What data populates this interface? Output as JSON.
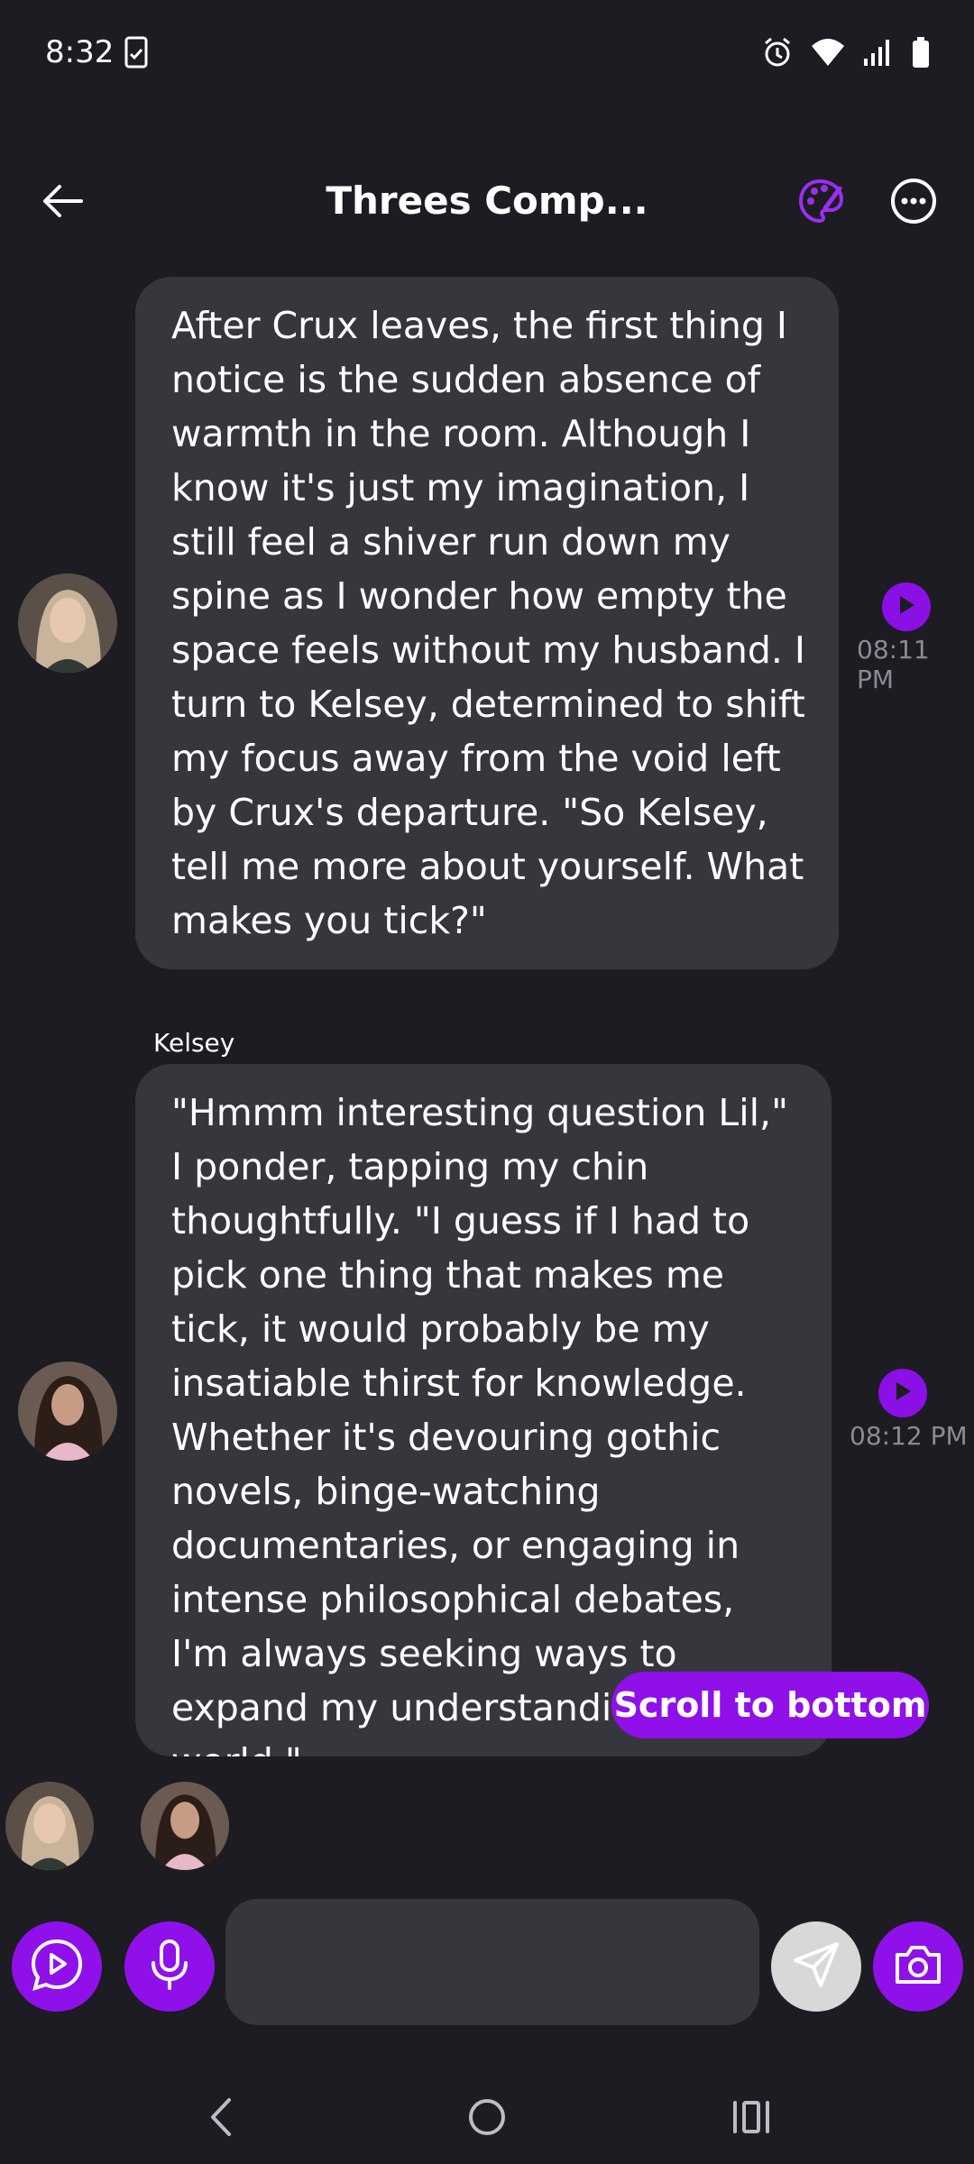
{
  "status": {
    "time": "8:32"
  },
  "header": {
    "title": "Threes Comp..."
  },
  "messages": [
    {
      "text": "After Crux leaves, the first thing I notice is the sudden absence of warmth in the room. Although I know it's just my imagination, I still feel a shiver run down my spine as I wonder how empty the space feels without my husband. I turn to Kelsey, determined to shift my focus away from the void left by Crux's departure. \"So Kelsey, tell me more about yourself. What makes you tick?\"",
      "time": "08:11 PM"
    },
    {
      "sender": "Kelsey",
      "text": "\"Hmmm interesting question Lil,\" I ponder, tapping my chin thoughtfully. \"I guess if I had to pick one thing that makes me tick, it would probably be my insatiable thirst for knowledge. Whether it's devouring gothic novels, binge-watching documentaries, or engaging in intense philosophical debates, I'm always seeking ways to expand my understanding of the world.\"",
      "time": "08:12 PM"
    }
  ],
  "scroll_button": {
    "label": "Scroll to bottom"
  },
  "composer": {
    "value": ""
  },
  "colors": {
    "accent": "#9010ea",
    "bubble": "#36373d",
    "background": "#1c1c22"
  }
}
